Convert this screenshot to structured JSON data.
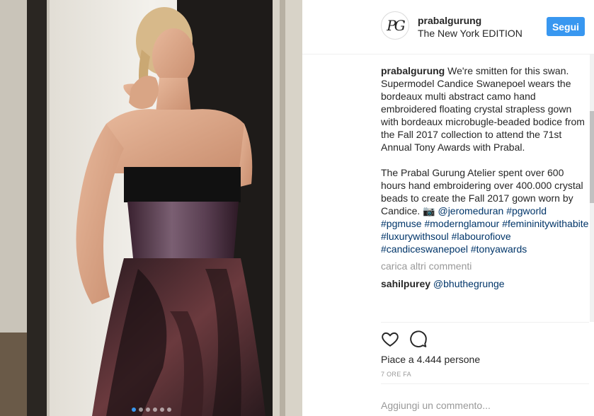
{
  "post": {
    "username": "prabalgurung",
    "location": "The New York EDITION",
    "follow_label": "Segui",
    "avatar_letters": "PG",
    "caption_p1": "We're smitten for this swan. Supermodel Candice Swanepoel wears the bordeaux multi abstract camo hand embroidered floating crystal strapless gown with bordeaux microbugle-beaded bodice from the Fall 2017 collection to attend the 71st Annual Tony Awards with Prabal.",
    "caption_p2": "The Prabal Gurung Atelier spent over 600 hours hand embroidering over 400.000 crystal beads to create the Fall 2017 gown worn by Candice.",
    "camera_emoji": "📷",
    "mention": "@jeromeduran",
    "hashtags": [
      "#pgworld",
      "#pgmuse",
      "#modernglamour",
      "#femininitywithabite",
      "#luxurywithsoul",
      "#labourofiove",
      "#candiceswanepoel",
      "#tonyawards"
    ],
    "load_more": "carica altri commenti",
    "comment": {
      "user": "sahilpurey",
      "text": "@bhuthegrunge"
    },
    "likes": "Piace a 4.444 persone",
    "time": "7 ORE FA",
    "comment_placeholder": "Aggiungi un commento...",
    "carousel": {
      "count": 6,
      "active": 0
    }
  },
  "colors": {
    "accent": "#3897f0",
    "link": "#003569",
    "muted": "#999999"
  },
  "icons": [
    "heart-icon",
    "comment-bubble-icon"
  ]
}
